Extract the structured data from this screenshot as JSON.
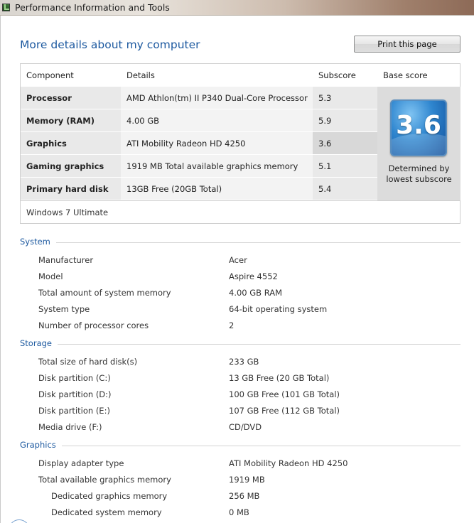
{
  "window": {
    "title": "Performance Information and Tools"
  },
  "header": {
    "title": "More details about my computer",
    "print_label": "Print this page"
  },
  "score_table": {
    "columns": [
      "Component",
      "Details",
      "Subscore",
      "Base score"
    ],
    "rows": [
      {
        "component": "Processor",
        "details": "AMD Athlon(tm) II P340 Dual-Core Processor",
        "subscore": "5.3"
      },
      {
        "component": "Memory (RAM)",
        "details": "4.00 GB",
        "subscore": "5.9"
      },
      {
        "component": "Graphics",
        "details": "ATI Mobility Radeon HD 4250",
        "subscore": "3.6"
      },
      {
        "component": "Gaming graphics",
        "details": "1919 MB Total available graphics memory",
        "subscore": "5.1"
      },
      {
        "component": "Primary hard disk",
        "details": "13GB Free (20GB Total)",
        "subscore": "5.4"
      }
    ],
    "base_score": "3.6",
    "base_caption_line1": "Determined by",
    "base_caption_line2": "lowest subscore",
    "os": "Windows 7 Ultimate"
  },
  "system": {
    "heading": "System",
    "items": [
      {
        "k": "Manufacturer",
        "v": "Acer"
      },
      {
        "k": "Model",
        "v": "Aspire 4552"
      },
      {
        "k": "Total amount of system memory",
        "v": "4.00 GB RAM"
      },
      {
        "k": "System type",
        "v": "64-bit operating system"
      },
      {
        "k": "Number of processor cores",
        "v": "2"
      }
    ]
  },
  "storage": {
    "heading": "Storage",
    "items": [
      {
        "k": "Total size of hard disk(s)",
        "v": "233 GB"
      },
      {
        "k": "Disk partition (C:)",
        "v": "13 GB Free (20 GB Total)"
      },
      {
        "k": "Disk partition (D:)",
        "v": "100 GB Free (101 GB Total)"
      },
      {
        "k": "Disk partition (E:)",
        "v": "107 GB Free (112 GB Total)"
      },
      {
        "k": "Media drive (F:)",
        "v": "CD/DVD"
      }
    ]
  },
  "graphics": {
    "heading": "Graphics",
    "items": [
      {
        "k": "Display adapter type",
        "v": "ATI Mobility Radeon HD 4250"
      },
      {
        "k": "Total available graphics memory",
        "v": "1919 MB"
      },
      {
        "k": "Dedicated graphics memory",
        "v": "256 MB"
      },
      {
        "k": "Dedicated system memory",
        "v": "0 MB"
      }
    ]
  }
}
